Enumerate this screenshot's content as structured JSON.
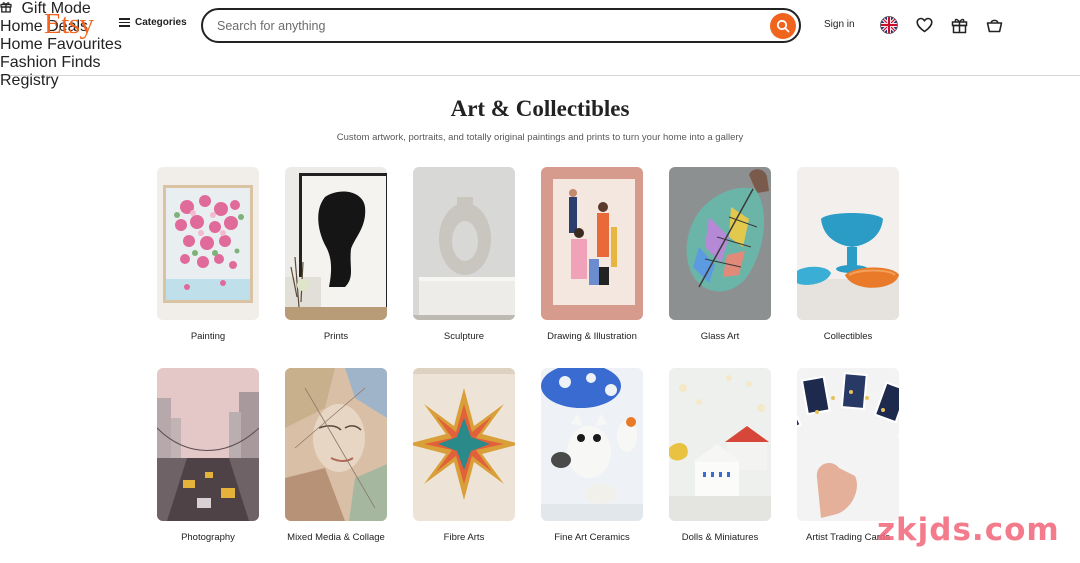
{
  "header": {
    "logo": "Etsy",
    "categories_label": "Categories",
    "search_placeholder": "Search for anything",
    "signin_label": "Sign in"
  },
  "subnav": {
    "items": [
      "Gift Mode",
      "Home Deals",
      "Home Favourites",
      "Fashion Finds",
      "Registry"
    ]
  },
  "main": {
    "title": "Art & Collectibles",
    "subtitle": "Custom artwork, portraits, and totally original paintings and prints to turn your home into a gallery",
    "categories": [
      {
        "label": "Painting"
      },
      {
        "label": "Prints"
      },
      {
        "label": "Sculpture"
      },
      {
        "label": "Drawing & Illustration"
      },
      {
        "label": "Glass Art"
      },
      {
        "label": "Collectibles"
      },
      {
        "label": "Photography"
      },
      {
        "label": "Mixed Media & Collage"
      },
      {
        "label": "Fibre Arts"
      },
      {
        "label": "Fine Art Ceramics"
      },
      {
        "label": "Dolls & Miniatures"
      },
      {
        "label": "Artist Trading Cards"
      }
    ]
  },
  "watermark": "zkjds.com",
  "colors": {
    "brand": "#f1641e",
    "text": "#222222",
    "muted": "#595959"
  }
}
